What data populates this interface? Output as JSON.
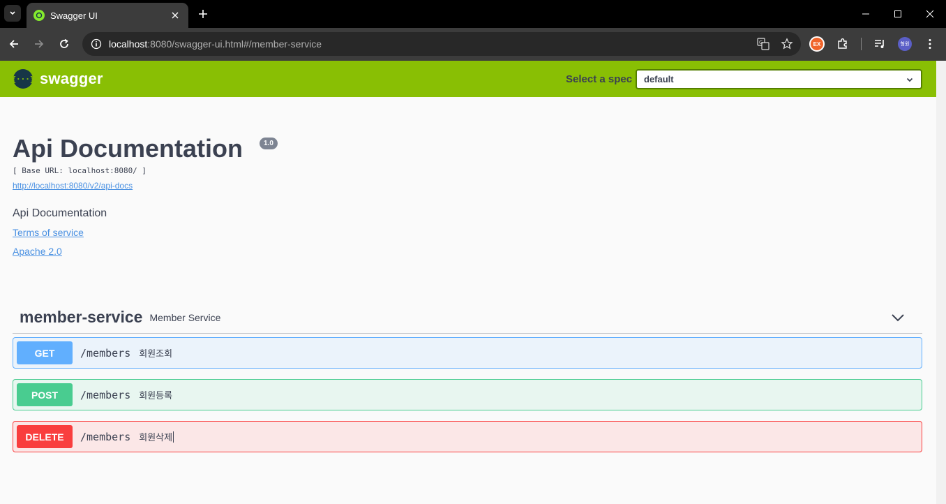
{
  "browser": {
    "tab_title": "Swagger UI",
    "url_host": "localhost",
    "url_rest": ":8080/swagger-ui.html#/member-service",
    "extension_badge": "EX",
    "profile_initials": "형원"
  },
  "topbar": {
    "logo_mark": "{···}",
    "logo_text": "swagger",
    "spec_label": "Select a spec",
    "spec_value": "default"
  },
  "info": {
    "title": "Api Documentation",
    "version": "1.0",
    "base_url": "[ Base URL: localhost:8080/ ]",
    "docs_link": "http://localhost:8080/v2/api-docs",
    "description": "Api Documentation",
    "terms_link": "Terms of service",
    "license_link": "Apache 2.0"
  },
  "tag": {
    "name": "member-service",
    "description": "Member Service"
  },
  "operations": [
    {
      "method": "GET",
      "path": "/members",
      "summary": "회원조회"
    },
    {
      "method": "POST",
      "path": "/members",
      "summary": "회원등록"
    },
    {
      "method": "DELETE",
      "path": "/members",
      "summary": "회원삭제"
    }
  ],
  "colors": {
    "swagger_green": "#89bf04",
    "get": "#61affe",
    "post": "#49cc90",
    "delete": "#f93e3e"
  }
}
